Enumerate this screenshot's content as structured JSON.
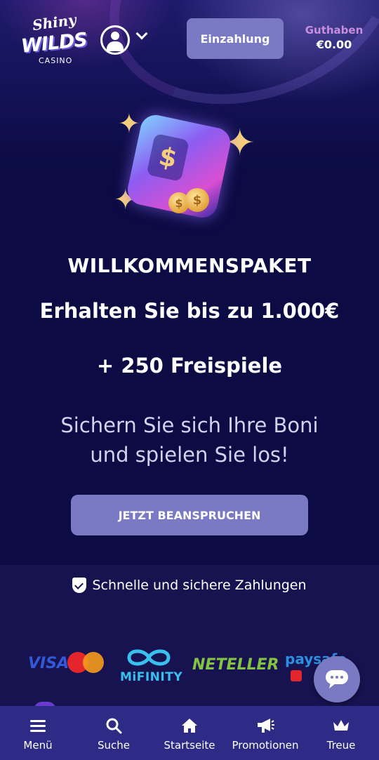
{
  "header": {
    "logo": {
      "line1": "Shiny",
      "line2": "WILDS",
      "line3": "CASINO"
    },
    "deposit_label": "Einzahlung",
    "balance_label": "Guthaben",
    "balance_value": "€0.00",
    "icons": {
      "user": "user-circle-icon",
      "dropdown": "chevron-down-icon"
    }
  },
  "hero": {
    "title": "WILLKOMMENSPAKET",
    "amount": "Erhalten Sie bis zu 1.000€",
    "spins": "+ 250 Freispiele",
    "subtitle": "Sichern Sie sich Ihre Boni und spielen Sie los!",
    "cta_label": "JETZT BEANSPRUCHEN"
  },
  "payments": {
    "heading": "Schnelle und sichere Zahlungen",
    "providers": [
      "VISA",
      "MiFINITY",
      "NETELLER",
      "paysafe"
    ]
  },
  "bottom_nav": {
    "items": [
      {
        "label": "Menü",
        "icon": "menu-icon"
      },
      {
        "label": "Suche",
        "icon": "search-icon"
      },
      {
        "label": "Startseite",
        "icon": "home-icon"
      },
      {
        "label": "Promotionen",
        "icon": "megaphone-icon"
      },
      {
        "label": "Treue",
        "icon": "crown-icon"
      }
    ]
  },
  "colors": {
    "background": "#0c0b44",
    "button": "#7a79c4",
    "nav": "#2d2b86",
    "balance_label": "#c88ee0",
    "payments_bg": "#161350"
  }
}
